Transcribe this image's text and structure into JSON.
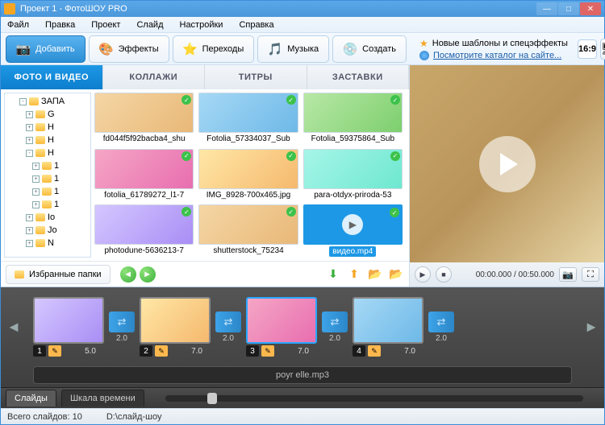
{
  "window_title": "Проект 1 - ФотоШОУ PRO",
  "menu": [
    "Файл",
    "Правка",
    "Проект",
    "Слайд",
    "Настройки",
    "Справка"
  ],
  "toolbar": {
    "add": "Добавить",
    "effects": "Эффекты",
    "transitions": "Переходы",
    "music": "Музыка",
    "create": "Создать"
  },
  "help": {
    "line1": "Новые шаблоны и спецэффекты",
    "link": "Посмотрите каталог на сайте..."
  },
  "ratio": "16:9",
  "tabs": [
    "ФОТО И ВИДЕО",
    "КОЛЛАЖИ",
    "ТИТРЫ",
    "ЗАСТАВКИ"
  ],
  "tree": [
    {
      "t": "-",
      "label": "ЗАПА",
      "depth": 2
    },
    {
      "t": "+",
      "label": "G",
      "depth": 3
    },
    {
      "t": "+",
      "label": "H",
      "depth": 3
    },
    {
      "t": "+",
      "label": "H",
      "depth": 3
    },
    {
      "t": "-",
      "label": "H",
      "depth": 3
    },
    {
      "t": "+",
      "label": "1",
      "depth": 4
    },
    {
      "t": "+",
      "label": "1",
      "depth": 4
    },
    {
      "t": "+",
      "label": "1",
      "depth": 4
    },
    {
      "t": "+",
      "label": "1",
      "depth": 4
    },
    {
      "t": "+",
      "label": "Io",
      "depth": 3
    },
    {
      "t": "+",
      "label": "Jo",
      "depth": 3
    },
    {
      "t": "+",
      "label": "N",
      "depth": 3
    }
  ],
  "thumbs": [
    {
      "name": "fd044f5f92bacba4_shu",
      "g": "g1"
    },
    {
      "name": "Fotolia_57334037_Sub",
      "g": "g2"
    },
    {
      "name": "Fotolia_59375864_Sub",
      "g": "g3"
    },
    {
      "name": "fotolia_61789272_l1-7",
      "g": "g4"
    },
    {
      "name": "IMG_8928-700x465.jpg",
      "g": "g6"
    },
    {
      "name": "para-otdyx-priroda-53",
      "g": "g7"
    },
    {
      "name": "photodune-5636213-7",
      "g": "g5"
    },
    {
      "name": "shutterstock_75234",
      "g": "g1"
    },
    {
      "name": "видео.mp4",
      "g": "g8",
      "video": true,
      "selected": true
    }
  ],
  "fav_btn": "Избранные папки",
  "preview_time": "00:00.000 / 00:50.000",
  "slides": [
    {
      "n": "1",
      "dur": "5.0",
      "g": "g5"
    },
    {
      "n": "2",
      "dur": "7.0",
      "g": "g6"
    },
    {
      "n": "3",
      "dur": "7.0",
      "g": "g4",
      "selected": true
    },
    {
      "n": "4",
      "dur": "7.0",
      "g": "g2"
    }
  ],
  "trans_dur": "2.0",
  "audio_name": "poyr elle.mp3",
  "tl_tabs": [
    "Слайды",
    "Шкала времени"
  ],
  "status": {
    "slides": "Всего слайдов: 10",
    "path": "D:\\слайд-шоу"
  }
}
